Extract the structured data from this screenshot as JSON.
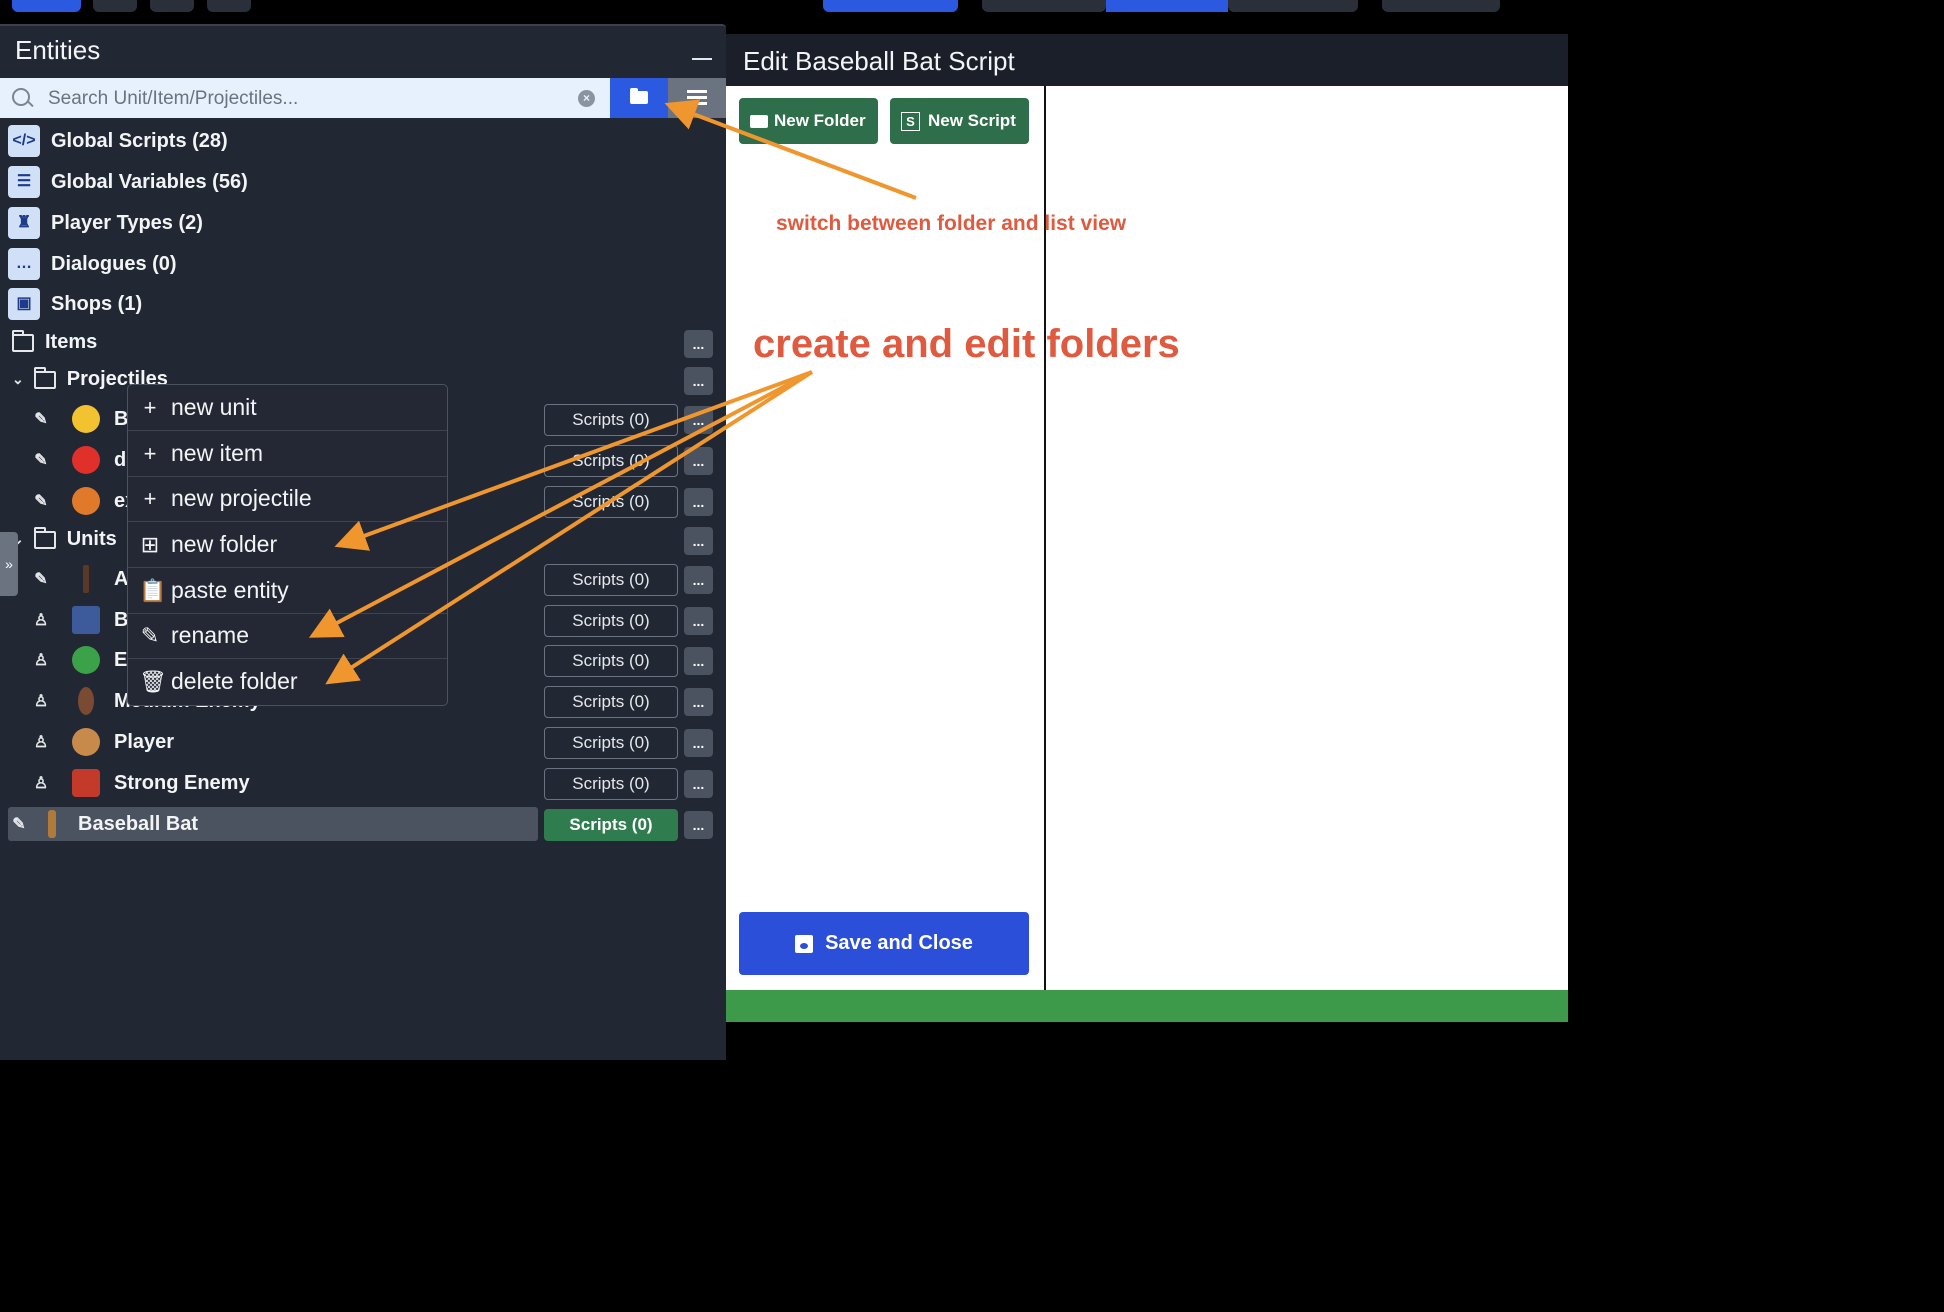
{
  "panel": {
    "title": "Entities",
    "search_placeholder": "Search Unit/Item/Projectiles...",
    "clear_icon": "x-circle-icon"
  },
  "globals": [
    {
      "label": "Global Scripts (28)",
      "icon": "code-icon"
    },
    {
      "label": "Global Variables (56)",
      "icon": "list-icon"
    },
    {
      "label": "Player Types (2)",
      "icon": "castle-icon"
    },
    {
      "label": "Dialogues (0)",
      "icon": "chat-icon"
    },
    {
      "label": "Shops (1)",
      "icon": "bag-icon"
    }
  ],
  "folders": {
    "items": "Items",
    "projectiles": "Projectiles",
    "units": "Units"
  },
  "projectiles": [
    {
      "name": "Bu",
      "scripts": "Scripts (0)"
    },
    {
      "name": "de",
      "scripts": "Scripts (0)"
    },
    {
      "name": "ex",
      "scripts": "Scripts (0)"
    }
  ],
  "units": [
    {
      "name": "Ak",
      "scripts": "Scripts (0)"
    },
    {
      "name": "Ba",
      "scripts": "Scripts (0)"
    },
    {
      "name": "Ea",
      "scripts": "Scripts (0)"
    },
    {
      "name": "Medium Enemy",
      "scripts": "Scripts (0)"
    },
    {
      "name": "Player",
      "scripts": "Scripts (0)"
    },
    {
      "name": "Strong Enemy",
      "scripts": "Scripts (0)"
    }
  ],
  "selected_entity": {
    "name": "Baseball Bat",
    "scripts": "Scripts (0)"
  },
  "dots_label": "...",
  "context_menu": [
    {
      "icon": "+",
      "label": "new unit"
    },
    {
      "icon": "+",
      "label": "new item"
    },
    {
      "icon": "+",
      "label": "new projectile"
    },
    {
      "icon": "⊞",
      "label": "new folder"
    },
    {
      "icon": "📋",
      "label": "paste entity"
    },
    {
      "icon": "✎",
      "label": "rename"
    },
    {
      "icon": "🗑",
      "label": "delete folder"
    }
  ],
  "dialog": {
    "title": "Edit Baseball Bat Script",
    "new_folder": "New Folder",
    "new_script": "New Script",
    "new_script_icon_letter": "S",
    "save": "Save and Close"
  },
  "annotations": {
    "switch_view": "switch between folder and list view",
    "folders": "create and edit folders"
  },
  "colors": {
    "accent_blue": "#2b59e0",
    "green_button": "#2f6e4a",
    "annotation_red": "#e05a3f",
    "arrow_orange": "#f0962e"
  }
}
